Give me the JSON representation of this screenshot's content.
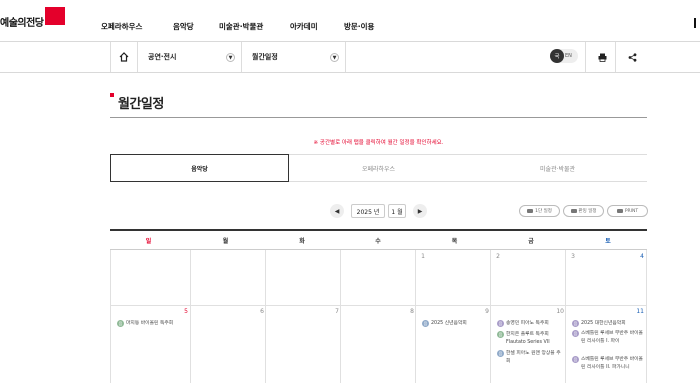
{
  "header": {
    "logo_text": "예술의전당",
    "nav": [
      "오페라하우스",
      "음악당",
      "미술관·박물관",
      "아카데미",
      "방문·이용"
    ]
  },
  "subnav": {
    "home_icon": "home-icon",
    "crumb1": "공연·전시",
    "crumb2": "월간일정",
    "lang_ko": "국",
    "lang_en": "EN",
    "print_icon": "print-icon",
    "share_icon": "share-icon"
  },
  "page": {
    "title": "월간일정",
    "notice": "※ 공간별로 아래 탭을 클릭하여 월간 일정을 확인하세요."
  },
  "tabs": [
    "음악당",
    "오페라하우스",
    "미술관·박물관"
  ],
  "month_nav": {
    "prev": "◀",
    "year": "2025 년",
    "month": "1 월",
    "next": "▶"
  },
  "actions": [
    "1단 일정",
    "판밍 일정",
    "PRINT"
  ],
  "calendar": {
    "days": [
      "일",
      "월",
      "화",
      "수",
      "목",
      "금",
      "토"
    ],
    "week1": [
      "",
      "",
      "",
      "1",
      "2",
      "3",
      "4"
    ],
    "week2": [
      "5",
      "6",
      "7",
      "8",
      "9",
      "10",
      "11"
    ],
    "events": {
      "sun5": [
        {
          "icon": "음",
          "text": "마지동 바이올린 독주회"
        }
      ],
      "thu9": [
        {
          "icon": "음",
          "text": "2025 신년음악회"
        }
      ],
      "fri10": [
        {
          "icon": "음",
          "text": "송영민 피아노 독주회"
        },
        {
          "icon": "음",
          "text": "한지은 플루트 독주회 Flautato Series VII"
        },
        {
          "icon": "음",
          "text": "한셀 피아노 원맨 앙상블 주회"
        }
      ],
      "sat11": [
        {
          "icon": "음",
          "text": "2025 대한신년음악회"
        },
        {
          "icon": "음",
          "text": "스베틀린 루세브 무반주 바이올린 리사이틀 I. 파이"
        },
        {
          "icon": "음",
          "text": "스베틀린 루세브 무반주 바이올린 리사이틀 II. 파가니니"
        }
      ]
    }
  },
  "colors": {
    "accent": "#e4002b",
    "sun": "#e4002b",
    "sat": "#1a5fb4",
    "event_green": "#8fb996",
    "event_purple": "#a89cc8",
    "event_blue": "#8fa9c8"
  }
}
